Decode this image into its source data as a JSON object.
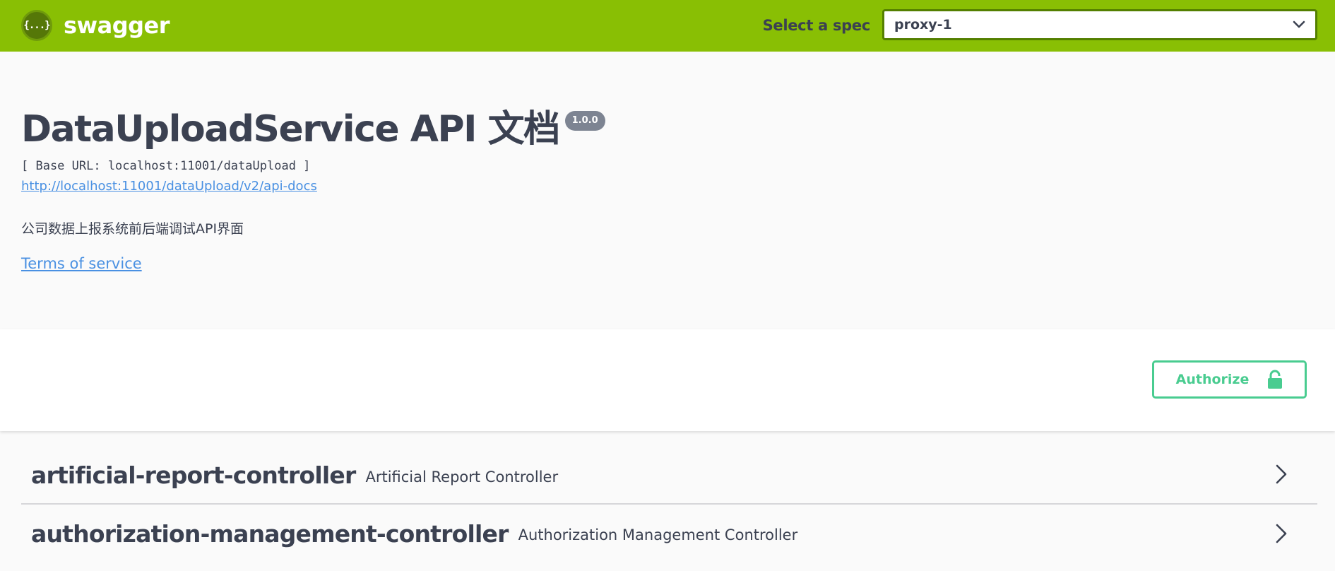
{
  "topbar": {
    "brand": "swagger",
    "logo_glyph": "{...}",
    "spec_label": "Select a spec",
    "spec_selected": "proxy-1",
    "colors": {
      "background": "#89bf04",
      "select_border": "#547f00"
    }
  },
  "info": {
    "title": "DataUploadService API 文档",
    "version": "1.0.0",
    "base_url": "[ Base URL: localhost:11001/dataUpload ]",
    "api_docs_link": "http://localhost:11001/dataUpload/v2/api-docs",
    "description": "公司数据上报系统前后端调试API界面",
    "terms": "Terms of service"
  },
  "scheme": {
    "authorize_label": "Authorize",
    "authorize_color": "#49cc90",
    "authorize_icon": "lock-icon"
  },
  "tags": [
    {
      "name": "artificial-report-controller",
      "description": "Artificial Report Controller"
    },
    {
      "name": "authorization-management-controller",
      "description": "Authorization Management Controller"
    }
  ]
}
